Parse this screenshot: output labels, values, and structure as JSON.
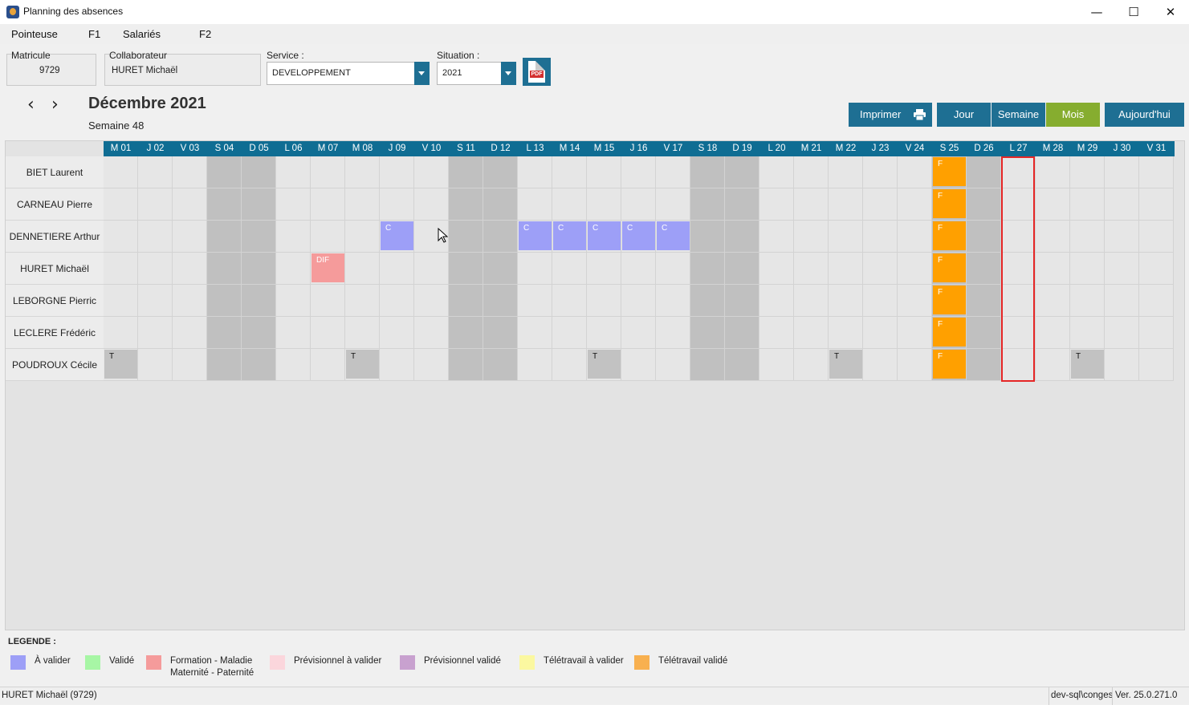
{
  "window": {
    "title": "Planning des absences",
    "controls": {
      "minimize": "—",
      "maximize": "☐",
      "close": "✕"
    }
  },
  "menu": [
    "Pointeuse",
    "F1",
    "Salariés",
    "F2"
  ],
  "form": {
    "matricule_label": "Matricule",
    "matricule_value": "9729",
    "collaborateur_label": "Collaborateur",
    "collaborateur_value": "HURET Michaël",
    "service_label": "Service :",
    "service_value": "DEVELOPPEMENT",
    "situation_label": "Situation :",
    "situation_value": "2021",
    "pdf_label": "PDF"
  },
  "nav": {
    "prev": "‹",
    "next": "›",
    "month": "Décembre 2021",
    "week": "Semaine 48"
  },
  "buttons": {
    "print": "Imprimer",
    "day": "Jour",
    "week": "Semaine",
    "month": "Mois",
    "today": "Aujourd'hui"
  },
  "colors": {
    "accent": "#1e6f93",
    "active_view": "#86ad2f",
    "a_valider": "#9d9ff7",
    "valide": "#a7f6a5",
    "formation": "#f59b9b",
    "previsionnel_a_valider": "#fbd6dc",
    "previsionnel_valide": "#c8a1cf",
    "teletravail_a_valider": "#fbf8a0",
    "teletravail_valide": "#f8b04f",
    "ferie": "#ffa000",
    "teletravail": "#c2c2c2"
  },
  "days": [
    "M 01",
    "J 02",
    "V 03",
    "S 04",
    "D 05",
    "L 06",
    "M 07",
    "M 08",
    "J 09",
    "V 10",
    "S 11",
    "D 12",
    "L 13",
    "M 14",
    "M 15",
    "J 16",
    "V 17",
    "S 18",
    "D 19",
    "L 20",
    "M 21",
    "M 22",
    "J 23",
    "V 24",
    "S 25",
    "D 26",
    "L 27",
    "M 28",
    "M 29",
    "J 30",
    "V 31"
  ],
  "weekend_days": [
    3,
    4,
    10,
    11,
    17,
    18,
    24,
    25
  ],
  "today_index": 26,
  "employees": [
    "BIET Laurent",
    "CARNEAU Pierre",
    "DENNETIERE Arthur",
    "HURET Michaël",
    "LEBORGNE Pierric",
    "LECLERE Frédéric",
    "POUDROUX Cécile"
  ],
  "events": [
    {
      "row": 0,
      "day": 24,
      "code": "F",
      "type": "ferie"
    },
    {
      "row": 1,
      "day": 24,
      "code": "F",
      "type": "ferie"
    },
    {
      "row": 2,
      "day": 24,
      "code": "F",
      "type": "ferie"
    },
    {
      "row": 3,
      "day": 24,
      "code": "F",
      "type": "ferie"
    },
    {
      "row": 4,
      "day": 24,
      "code": "F",
      "type": "ferie"
    },
    {
      "row": 5,
      "day": 24,
      "code": "F",
      "type": "ferie"
    },
    {
      "row": 6,
      "day": 24,
      "code": "F",
      "type": "ferie"
    },
    {
      "row": 2,
      "day": 8,
      "code": "C",
      "type": "a_valider"
    },
    {
      "row": 2,
      "day": 12,
      "code": "C",
      "type": "a_valider"
    },
    {
      "row": 2,
      "day": 13,
      "code": "C",
      "type": "a_valider"
    },
    {
      "row": 2,
      "day": 14,
      "code": "C",
      "type": "a_valider"
    },
    {
      "row": 2,
      "day": 15,
      "code": "C",
      "type": "a_valider"
    },
    {
      "row": 2,
      "day": 16,
      "code": "C",
      "type": "a_valider"
    },
    {
      "row": 3,
      "day": 6,
      "code": "DIF",
      "type": "formation"
    },
    {
      "row": 6,
      "day": 0,
      "code": "T",
      "type": "teletravail"
    },
    {
      "row": 6,
      "day": 7,
      "code": "T",
      "type": "teletravail"
    },
    {
      "row": 6,
      "day": 14,
      "code": "T",
      "type": "teletravail"
    },
    {
      "row": 6,
      "day": 21,
      "code": "T",
      "type": "teletravail"
    },
    {
      "row": 6,
      "day": 28,
      "code": "T",
      "type": "teletravail"
    }
  ],
  "legend": {
    "title": "LEGENDE :",
    "items": [
      {
        "label": "À valider",
        "label2": "",
        "color_key": "a_valider"
      },
      {
        "label": "Validé",
        "label2": "",
        "color_key": "valide"
      },
      {
        "label": "Formation - Maladie",
        "label2": "Maternité - Paternité",
        "color_key": "formation"
      },
      {
        "label": "Prévisionnel à valider",
        "label2": "",
        "color_key": "previsionnel_a_valider"
      },
      {
        "label": "Prévisionnel validé",
        "label2": "",
        "color_key": "previsionnel_valide"
      },
      {
        "label": "Télétravail à valider",
        "label2": "",
        "color_key": "teletravail_a_valider"
      },
      {
        "label": "Télétravail validé",
        "label2": "",
        "color_key": "teletravail_valide"
      }
    ]
  },
  "status": {
    "user": "HURET Michaël (9729)",
    "db": "dev-sql\\conges",
    "version": "Ver. 25.0.271.0"
  }
}
